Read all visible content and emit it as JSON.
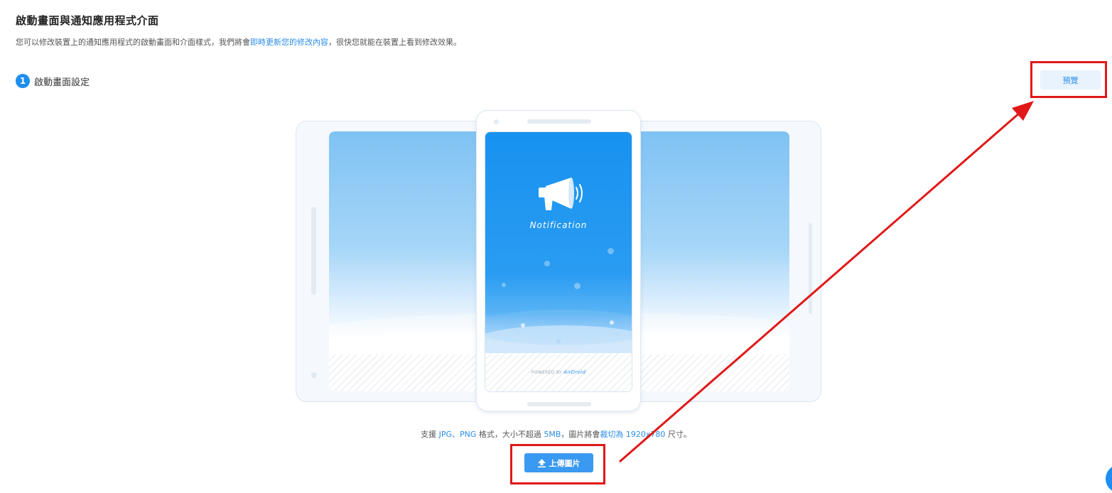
{
  "header": {
    "title": "啟動畫面與通知應用程式介面",
    "desc_before": "您可以修改裝置上的通知應用程式的啟動畫面和介面樣式，我們將會",
    "desc_link": "即時更新您的修改內容",
    "desc_after": "，很快您就能在裝置上看到修改效果。"
  },
  "step": {
    "number": "1",
    "title": "啟動畫面設定"
  },
  "toolbar": {
    "preview_label": "預覽"
  },
  "phone_preview": {
    "notification_label": "Notification",
    "powered_by": "POWERED BY",
    "brand": "AirDroid"
  },
  "support": {
    "part1": "支援 ",
    "formats": "JPG、PNG",
    "part2": " 格式，大小不超過 ",
    "max_size": "5MB",
    "part3": "，圖片將會",
    "crop_text": "裁切為 1920x780",
    "part4": " 尺寸。"
  },
  "upload": {
    "label": "上傳圖片"
  },
  "annotation_color": "#e01818",
  "accent_color": "#1d8ef0"
}
